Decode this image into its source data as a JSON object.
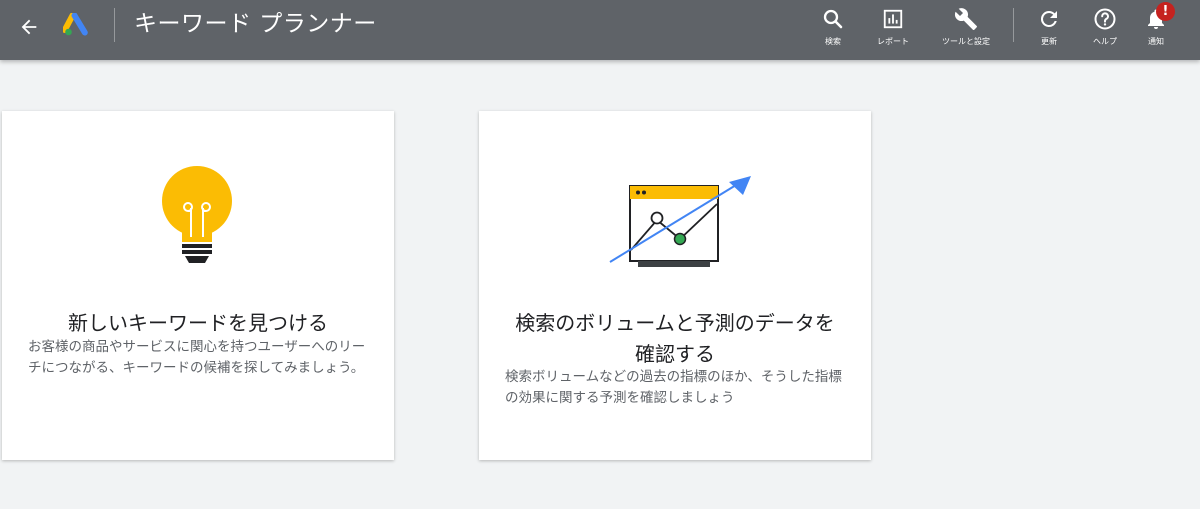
{
  "header": {
    "title": "キーワード プランナー",
    "tools": [
      {
        "name": "search",
        "label": "検索",
        "icon": "search-icon"
      },
      {
        "name": "report",
        "label": "レポート",
        "icon": "bar-chart-icon"
      },
      {
        "name": "tools-settings",
        "label": "ツールと設定",
        "icon": "wrench-icon"
      },
      {
        "name": "refresh",
        "label": "更新",
        "icon": "refresh-icon"
      },
      {
        "name": "help",
        "label": "ヘルプ",
        "icon": "help-icon"
      },
      {
        "name": "notifications",
        "label": "通知",
        "icon": "bell-icon"
      }
    ],
    "notification_badge": "!"
  },
  "cards": [
    {
      "title": "新しいキーワードを見つける",
      "description": "お客様の商品やサービスに関心を持つユーザーへのリーチにつながる、キーワードの候補を探してみましょう。",
      "icon": "lightbulb-icon"
    },
    {
      "title": "検索のボリュームと予測のデータを確認する",
      "description": "検索ボリュームなどの過去の指標のほか、そうした指標の効果に関する予測を確認しましょう",
      "icon": "trend-chart-icon"
    }
  ],
  "colors": {
    "topbar": "#5f6368",
    "background": "#f1f3f4",
    "accent_yellow": "#fbbc04",
    "accent_blue": "#4285f4",
    "accent_green": "#34a853",
    "badge_red": "#c5221f"
  }
}
